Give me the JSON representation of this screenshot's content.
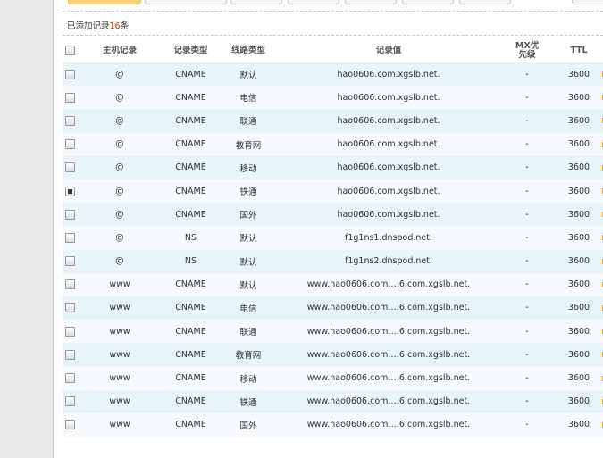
{
  "record_count": {
    "prefix": "已添加记录",
    "count": "16",
    "suffix": "条"
  },
  "table": {
    "columns": {
      "select": "",
      "host": "主机记录",
      "type": "记录类型",
      "line": "线路类型",
      "value": "记录值",
      "mx": "MX优先级",
      "ttl": "TTL"
    },
    "rows": [
      {
        "checked": false,
        "host": "@",
        "type": "CNAME",
        "line": "默认",
        "value": "hao0606.com.xgslb.net.",
        "mx": "-",
        "ttl": "3600"
      },
      {
        "checked": false,
        "host": "@",
        "type": "CNAME",
        "line": "电信",
        "value": "hao0606.com.xgslb.net.",
        "mx": "-",
        "ttl": "3600"
      },
      {
        "checked": false,
        "host": "@",
        "type": "CNAME",
        "line": "联通",
        "value": "hao0606.com.xgslb.net.",
        "mx": "-",
        "ttl": "3600"
      },
      {
        "checked": false,
        "host": "@",
        "type": "CNAME",
        "line": "教育网",
        "value": "hao0606.com.xgslb.net.",
        "mx": "-",
        "ttl": "3600"
      },
      {
        "checked": false,
        "host": "@",
        "type": "CNAME",
        "line": "移动",
        "value": "hao0606.com.xgslb.net.",
        "mx": "-",
        "ttl": "3600"
      },
      {
        "checked": true,
        "host": "@",
        "type": "CNAME",
        "line": "铁通",
        "value": "hao0606.com.xgslb.net.",
        "mx": "-",
        "ttl": "3600"
      },
      {
        "checked": false,
        "host": "@",
        "type": "CNAME",
        "line": "国外",
        "value": "hao0606.com.xgslb.net.",
        "mx": "-",
        "ttl": "3600"
      },
      {
        "checked": false,
        "host": "@",
        "type": "NS",
        "line": "默认",
        "value": "f1g1ns1.dnspod.net.",
        "mx": "-",
        "ttl": "3600"
      },
      {
        "checked": false,
        "host": "@",
        "type": "NS",
        "line": "默认",
        "value": "f1g1ns2.dnspod.net.",
        "mx": "-",
        "ttl": "3600"
      },
      {
        "checked": false,
        "host": "www",
        "type": "CNAME",
        "line": "默认",
        "value": "www.hao0606.com.…6.com.xgslb.net.",
        "mx": "-",
        "ttl": "3600"
      },
      {
        "checked": false,
        "host": "www",
        "type": "CNAME",
        "line": "电信",
        "value": "www.hao0606.com.…6.com.xgslb.net.",
        "mx": "-",
        "ttl": "3600"
      },
      {
        "checked": false,
        "host": "www",
        "type": "CNAME",
        "line": "联通",
        "value": "www.hao0606.com.…6.com.xgslb.net.",
        "mx": "-",
        "ttl": "3600"
      },
      {
        "checked": false,
        "host": "www",
        "type": "CNAME",
        "line": "教育网",
        "value": "www.hao0606.com.…6.com.xgslb.net.",
        "mx": "-",
        "ttl": "3600"
      },
      {
        "checked": false,
        "host": "www",
        "type": "CNAME",
        "line": "移动",
        "value": "www.hao0606.com.…6.com.xgslb.net.",
        "mx": "-",
        "ttl": "3600"
      },
      {
        "checked": false,
        "host": "www",
        "type": "CNAME",
        "line": "铁通",
        "value": "www.hao0606.com.…6.com.xgslb.net.",
        "mx": "-",
        "ttl": "3600"
      },
      {
        "checked": false,
        "host": "www",
        "type": "CNAME",
        "line": "国外",
        "value": "www.hao0606.com.…6.com.xgslb.net.",
        "mx": "-",
        "ttl": "3600"
      }
    ]
  },
  "colors": {
    "accent": "#e0301e",
    "row_odd": "#e9f4f8",
    "row_even": "#f7fafc",
    "toolbar_primary": "#f5d27a"
  }
}
